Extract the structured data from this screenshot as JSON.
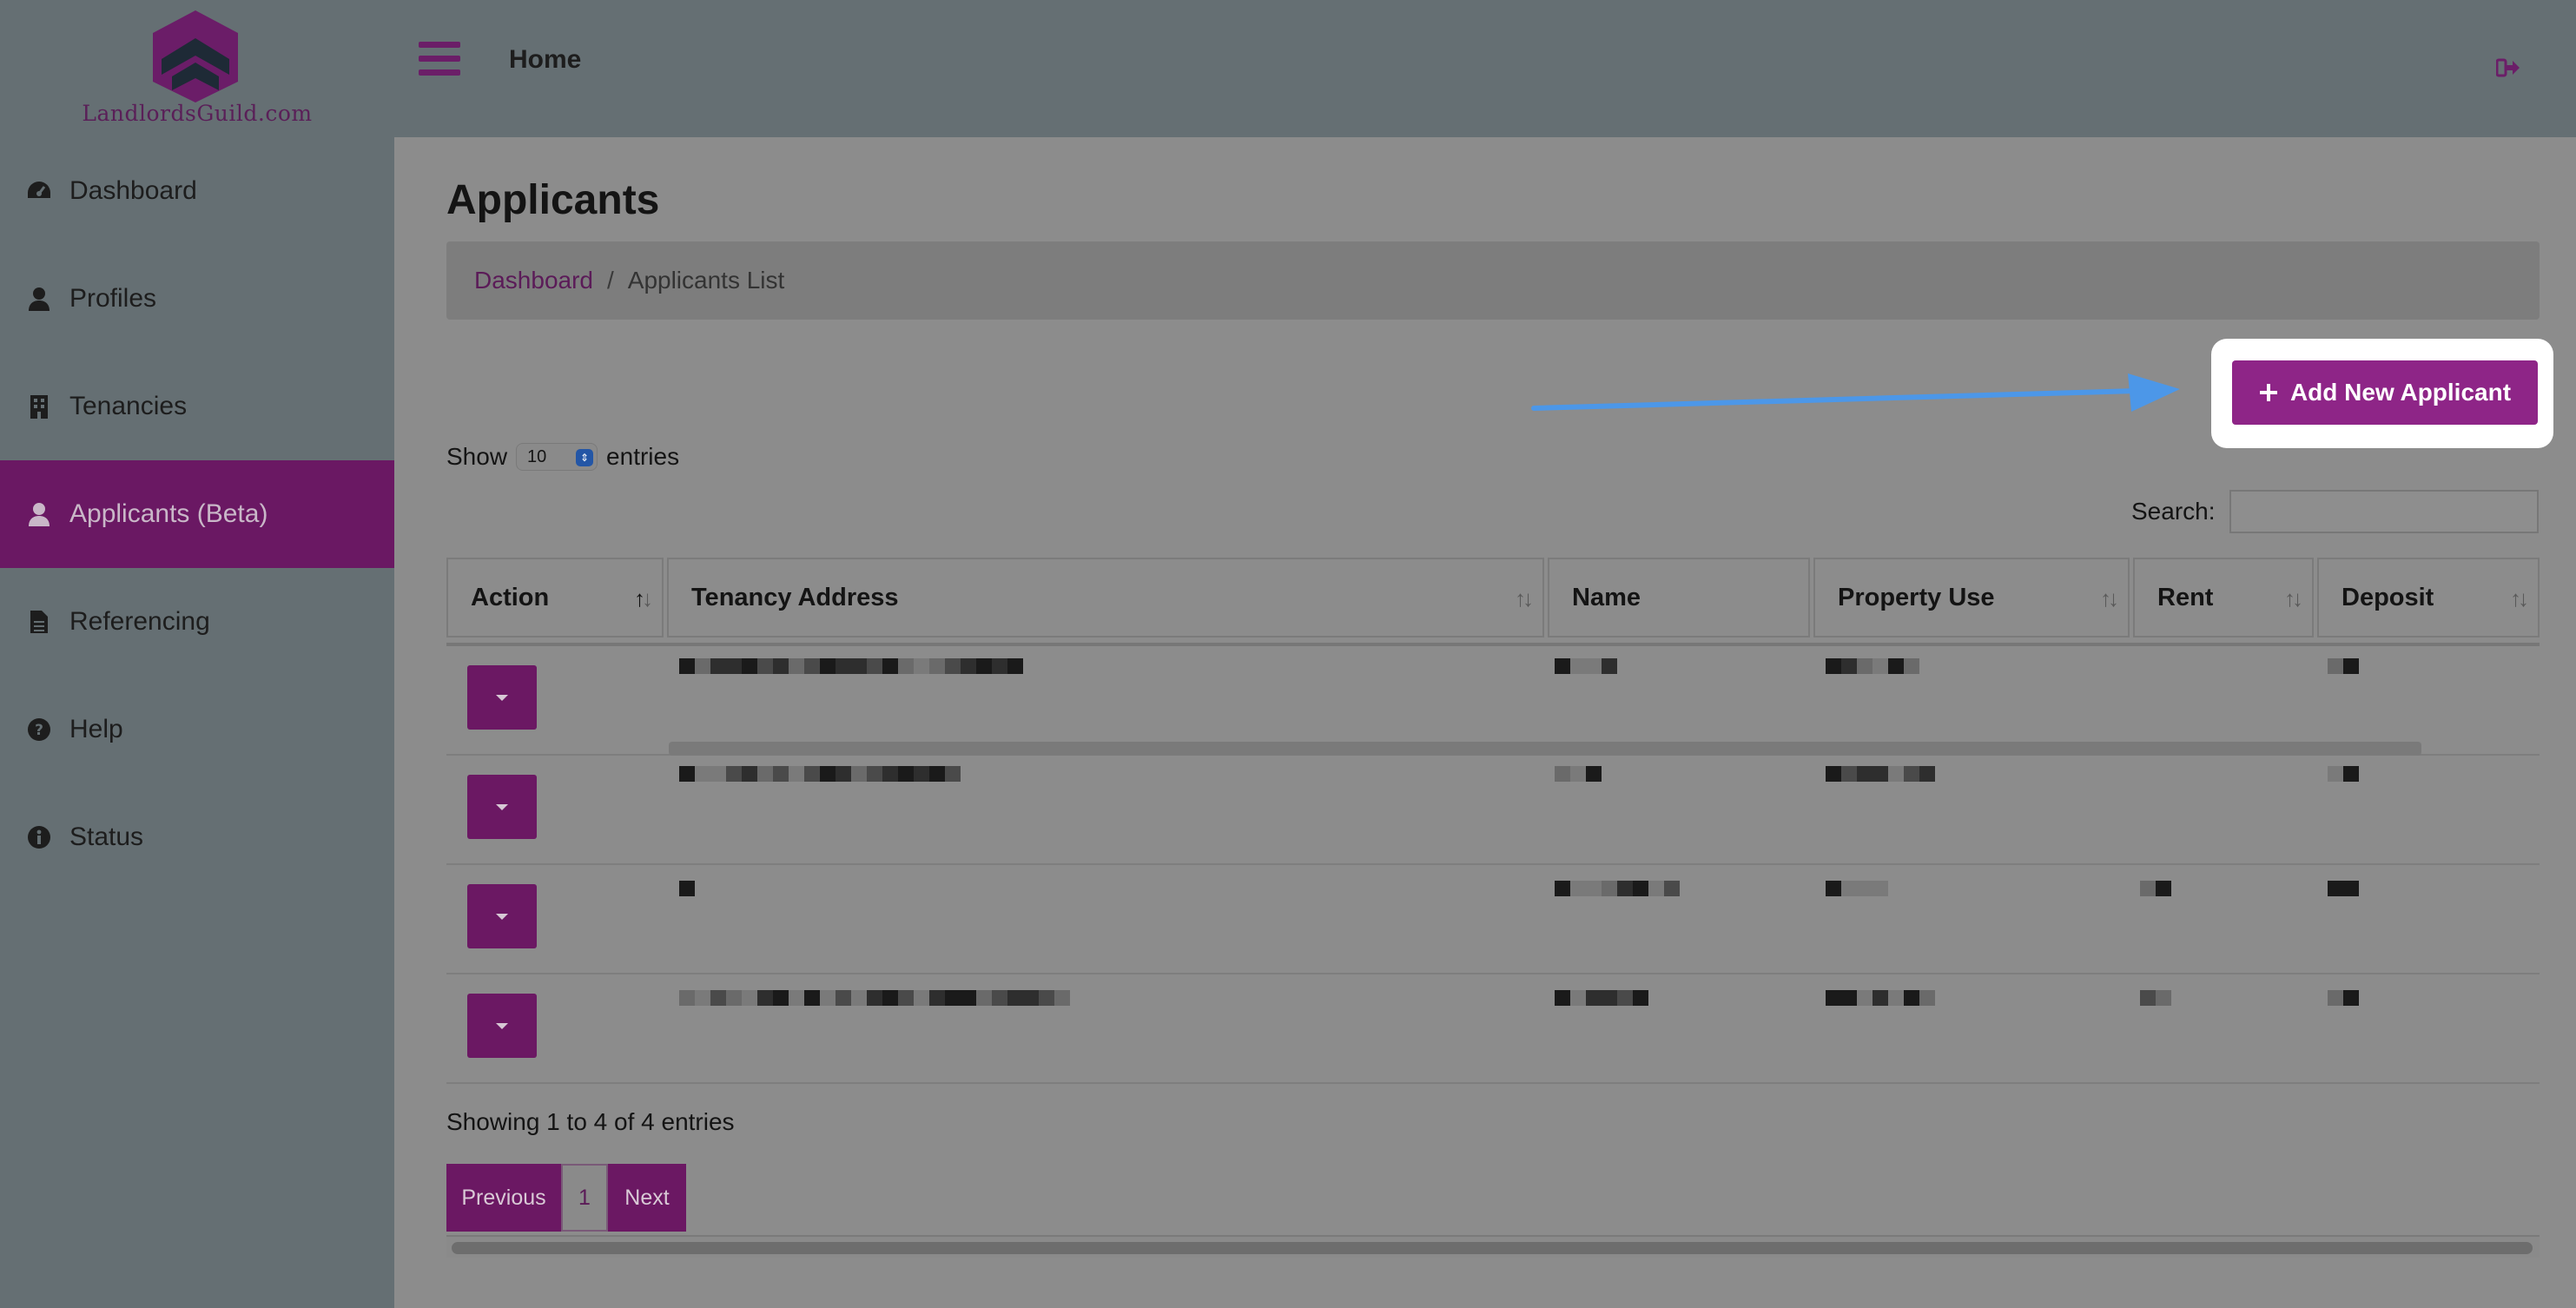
{
  "brand": {
    "name": "LandlordsGuild.com",
    "accent": "#6b1863"
  },
  "sidebar": {
    "items": [
      {
        "label": "Dashboard",
        "icon": "gauge-icon"
      },
      {
        "label": "Profiles",
        "icon": "user-icon"
      },
      {
        "label": "Tenancies",
        "icon": "building-icon"
      },
      {
        "label": "Applicants (Beta)",
        "icon": "user-icon",
        "active": true
      },
      {
        "label": "Referencing",
        "icon": "document-icon"
      },
      {
        "label": "Help",
        "icon": "question-circle-icon"
      },
      {
        "label": "Status",
        "icon": "info-circle-icon"
      }
    ]
  },
  "topbar": {
    "title": "Home",
    "logout_icon": "sign-out-icon",
    "menu_icon": "hamburger-icon"
  },
  "page": {
    "title": "Applicants",
    "breadcrumb": {
      "link": "Dashboard",
      "separator": "/",
      "current": "Applicants List"
    },
    "add_button": "Add New Applicant",
    "show": {
      "prefix": "Show",
      "value": "10",
      "suffix": "entries"
    },
    "search_label": "Search:",
    "search_value": ""
  },
  "table": {
    "columns": [
      "Action",
      "Tenancy Address",
      "Name",
      "Property Use",
      "Rent",
      "Deposit"
    ],
    "row_count": 4
  },
  "footer": {
    "showing": "Showing 1 to 4 of 4 entries",
    "pager": {
      "previous": "Previous",
      "page": "1",
      "next": "Next"
    }
  }
}
